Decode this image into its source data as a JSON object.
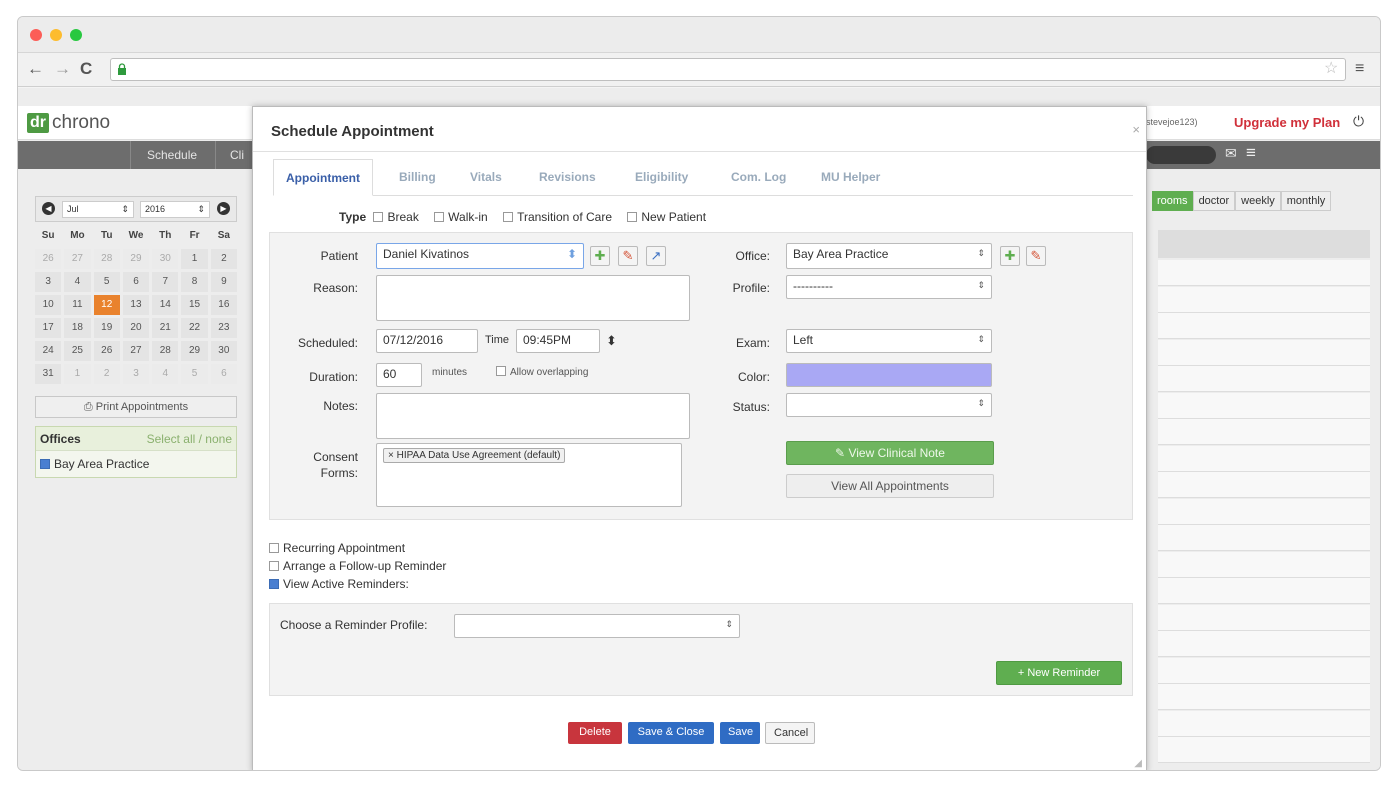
{
  "app": {
    "logo_dr": "dr",
    "logo_chrono": "chrono",
    "user": "stevejoe123)",
    "upgrade": "Upgrade my Plan"
  },
  "nav": {
    "schedule": "Schedule",
    "clinical": "Cli"
  },
  "calendar": {
    "month": "Jul",
    "year": "2016",
    "days_header": [
      "Su",
      "Mo",
      "Tu",
      "We",
      "Th",
      "Fr",
      "Sa"
    ],
    "weeks": [
      [
        "26",
        "27",
        "28",
        "29",
        "30",
        "1",
        "2"
      ],
      [
        "3",
        "4",
        "5",
        "6",
        "7",
        "8",
        "9"
      ],
      [
        "10",
        "11",
        "12",
        "13",
        "14",
        "15",
        "16"
      ],
      [
        "17",
        "18",
        "19",
        "20",
        "21",
        "22",
        "23"
      ],
      [
        "24",
        "25",
        "26",
        "27",
        "28",
        "29",
        "30"
      ],
      [
        "31",
        "1",
        "2",
        "3",
        "4",
        "5",
        "6"
      ]
    ],
    "selected_day": "12",
    "print_label": "Print Appointments"
  },
  "offices": {
    "title": "Offices",
    "select_all": "Select all / none",
    "items": [
      "Bay Area Practice"
    ]
  },
  "view_tabs": [
    "rooms",
    "doctor",
    "weekly",
    "monthly"
  ],
  "modal": {
    "title": "Schedule Appointment",
    "close": "×",
    "tabs": [
      "Appointment",
      "Billing",
      "Vitals",
      "Revisions",
      "Eligibility",
      "Com. Log",
      "MU Helper"
    ],
    "type_label": "Type",
    "types": [
      "Break",
      "Walk-in",
      "Transition of Care",
      "New Patient"
    ],
    "patient_label": "Patient",
    "patient_value": "Daniel Kivatinos",
    "reason_label": "Reason:",
    "scheduled_label": "Scheduled:",
    "scheduled_value": "07/12/2016",
    "time_label": "Time",
    "time_value": "09:45PM",
    "duration_label": "Duration:",
    "duration_value": "60",
    "minutes_label": "minutes",
    "allow_overlap": "Allow overlapping",
    "notes_label": "Notes:",
    "consent_label_1": "Consent",
    "consent_label_2": "Forms:",
    "consent_tag": "HIPAA Data Use Agreement (default)",
    "office_label": "Office:",
    "office_value": "Bay Area Practice",
    "profile_label": "Profile:",
    "profile_value": "----------",
    "exam_label": "Exam:",
    "exam_value": "Left",
    "color_label": "Color:",
    "color_value": "#a9a8f4",
    "status_label": "Status:",
    "status_value": "",
    "view_clinical": "View Clinical Note",
    "view_all": "View All Appointments",
    "recurring": "Recurring Appointment",
    "followup": "Arrange a Follow-up Reminder",
    "active_reminders": "View Active Reminders:",
    "reminder_profile_label": "Choose a Reminder Profile:",
    "new_reminder": "+ New Reminder",
    "delete": "Delete",
    "save_close": "Save & Close",
    "save": "Save",
    "cancel": "Cancel"
  },
  "colors": {
    "green": "#5fae50",
    "blue": "#2f6cc4",
    "red": "#c8353d",
    "upgrade_red": "#d0303a"
  }
}
